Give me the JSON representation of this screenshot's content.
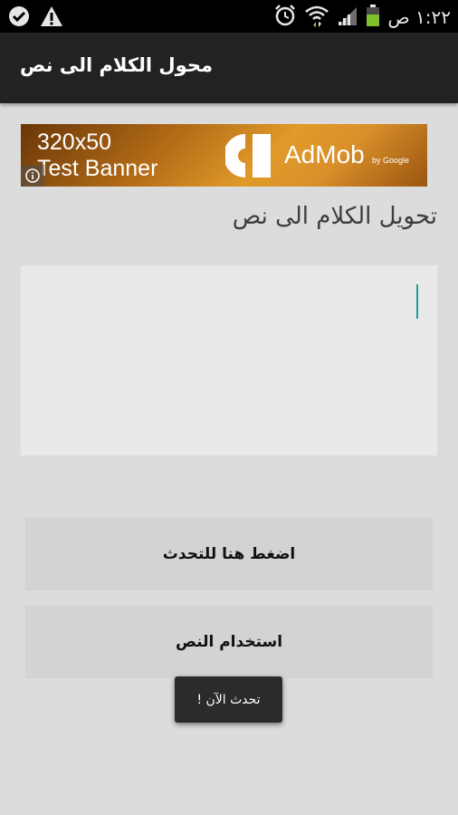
{
  "status_bar": {
    "time": "١:٢٢ ص",
    "icons": [
      "check-shield-icon",
      "warning-icon",
      "alarm-icon",
      "wifi-icon",
      "signal-icon",
      "battery-icon"
    ]
  },
  "action_bar": {
    "title": "محول الكلام الى نص"
  },
  "ad_banner": {
    "size_label": "320x50",
    "text": "Test Banner",
    "brand": "AdMob",
    "by_line": "by Google",
    "info_icon": "info-icon",
    "accent_color": "#d9902a"
  },
  "main": {
    "heading": "تحويل الكلام الى نص",
    "text_area_value": "",
    "buttons": {
      "speak_label": "اضغط هنا للتحدث",
      "use_text_label": "استخدام النص"
    },
    "toast": "تحدث الآن !",
    "cursor_color": "#1c9f95"
  }
}
